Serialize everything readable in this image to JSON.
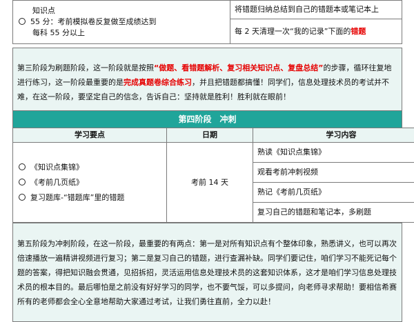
{
  "top": {
    "left_line1": "知识点",
    "left_line2": "55 分：考前模拟卷反复做至成绩达到",
    "left_line3": "每科 55 分以上",
    "right_row1": "将错题归纳总结到自己的错题本或笔记本上",
    "right_row2_prefix": "每 2 天清理一次“我的记录”下面的",
    "right_row2_red": "错题"
  },
  "stage3": {
    "p1": "第三阶段为刷题阶段，这一阶段就是按照",
    "p2_red": "“做题、看错题解析、复习相关知识点、复盘总结”",
    "p3": "的步骤，循环往复地进行练习，这一阶段最重要的是",
    "p4_red": "完成真题卷综合练习",
    "p5": "，并且把错题都搞懂！同学们，信息处理技术员的考试并不难，在这一阶段，要坚定自己的信念，告诉自己：坚持就是胜利！胜利就在眼前！"
  },
  "stage4": {
    "title": "第四阶段　冲刺",
    "headers": [
      "学习要点",
      "日期",
      "学习内容"
    ],
    "points": [
      "《知识点集锦》",
      "《考前几页纸》",
      "复习题库-“错题库”里的错题"
    ],
    "date": "考前 14 天",
    "contents": [
      "熟读《知识点集锦》",
      "观看考前冲刺视频",
      "熟记《考前几页纸》",
      "复习自己的错题和笔记本，多刷题"
    ]
  },
  "stage5": {
    "text": "第五阶段为冲刺阶段，在这一阶段，最重要的有两点：第一是对所有知识点有个整体印象，熟悉讲义，也可以再次倍速播放一遍精讲视频进行复习；第二是复习自己的错题，进行查漏补缺。同学们要记住，咱们学习不能死记每个题的答案，得把知识融会贯通，见招拆招，灵活运用信息处理技术员的这套知识体系，这才是咱们学习信息处理技术员的根本目的。最后哪怕是之前没有好好学习的同学，也不要气馁，可以多提问，向老师寻求帮助！要相信希赛所有的老师都会全心全意地帮助大家通过考试，让我们勇往直前，全力以赴！"
  }
}
